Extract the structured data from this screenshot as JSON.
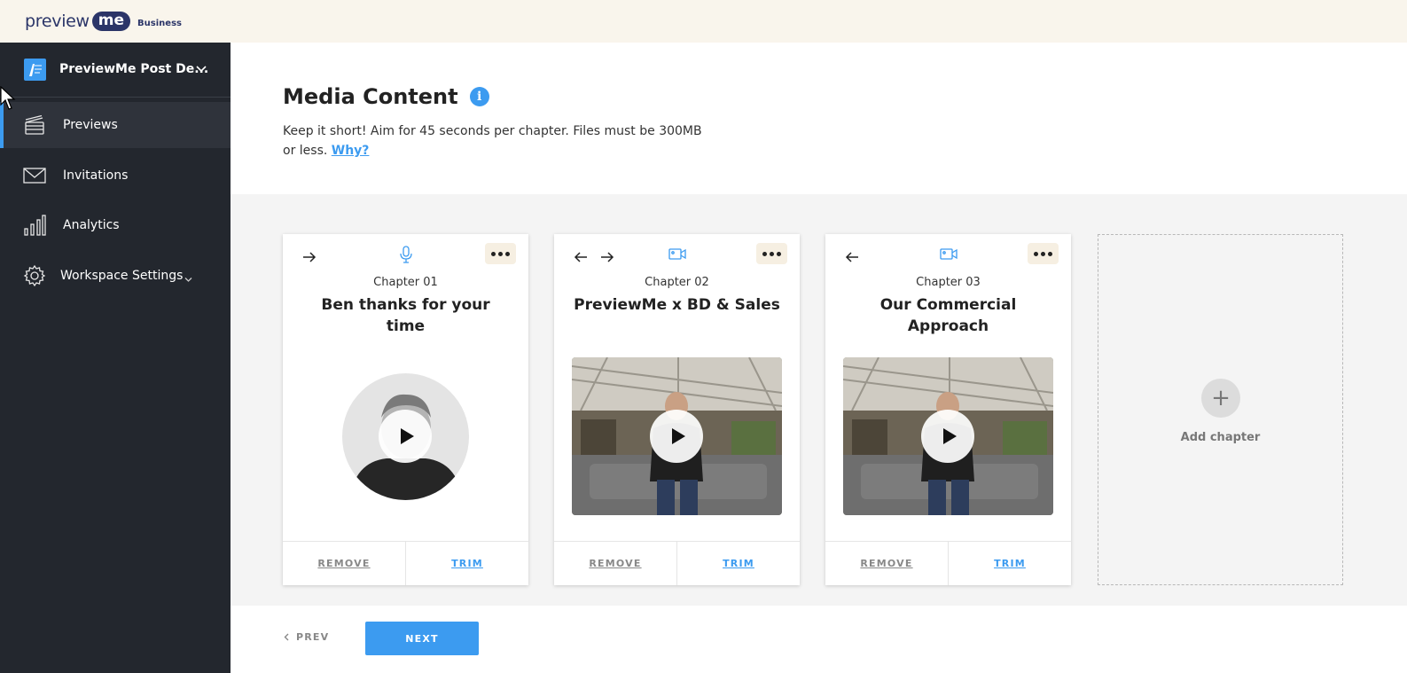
{
  "app": {
    "logo": {
      "word1": "preview",
      "word2": "me",
      "word3": "Business"
    }
  },
  "sidebar": {
    "workspace_name": "PreviewMe Post De...",
    "items": [
      {
        "label": "Previews",
        "icon": "clapperboard-icon",
        "active": true
      },
      {
        "label": "Invitations",
        "icon": "envelope-icon",
        "active": false
      },
      {
        "label": "Analytics",
        "icon": "bar-chart-icon",
        "active": false
      },
      {
        "label": "Workspace Settings",
        "icon": "gear-icon",
        "active": false
      }
    ]
  },
  "header": {
    "title": "Media Content",
    "info_glyph": "i",
    "subtitle": "Keep it short! Aim for 45 seconds per chapter. Files must be 300MB or less.",
    "why_link": "Why?"
  },
  "chapters": [
    {
      "number": "Chapter 01",
      "title": "Ben thanks for your time",
      "media_type": "microphone-icon",
      "thumb": "circle"
    },
    {
      "number": "Chapter 02",
      "title": "PreviewMe x BD & Sales",
      "media_type": "video-camera-icon",
      "thumb": "rect"
    },
    {
      "number": "Chapter 03",
      "title": "Our Commercial Approach",
      "media_type": "video-camera-icon",
      "thumb": "rect"
    }
  ],
  "card_actions": {
    "remove": "REMOVE",
    "trim": "TRIM"
  },
  "add_chapter": {
    "label": "Add chapter",
    "glyph": "+"
  },
  "footer": {
    "prev": "PREV",
    "next": "NEXT"
  },
  "colors": {
    "accent": "#3c9bf0",
    "sidebar_bg": "#23272e",
    "topbar_bg": "#f9f5ec",
    "content_bg": "#f4f4f4"
  }
}
